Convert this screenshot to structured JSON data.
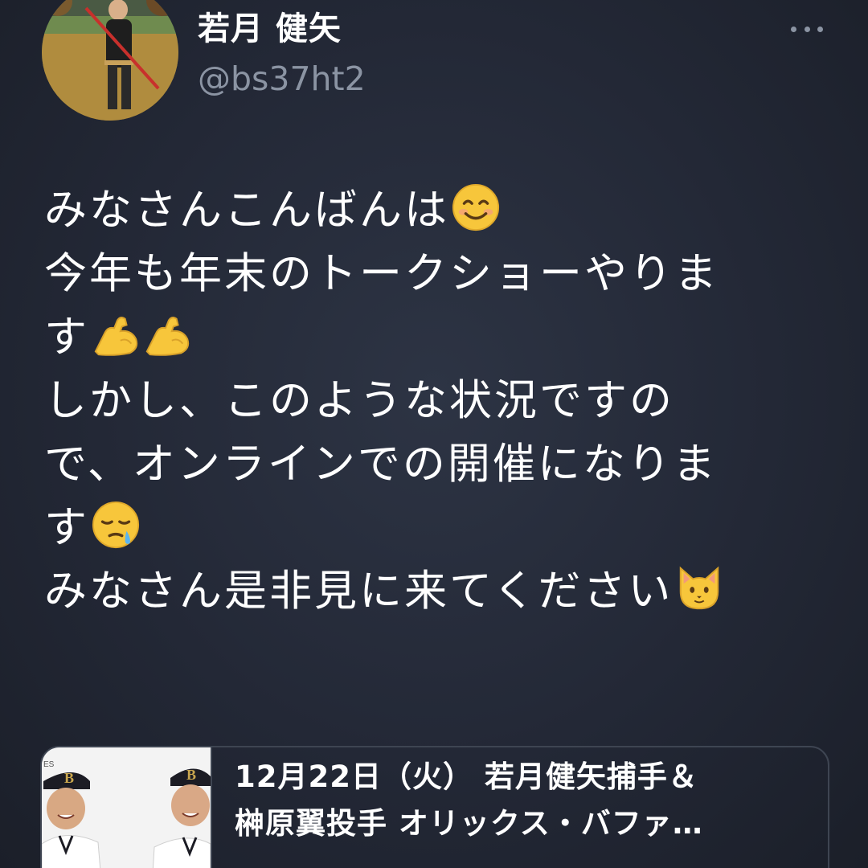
{
  "header": {
    "display_name": "若月 健矢",
    "handle": "@bs37ht2",
    "more_icon": "more-horizontal-icon"
  },
  "tweet": {
    "lines": [
      {
        "text": "みなさんこんばんは",
        "emoji": [
          "smiling-face-icon"
        ]
      },
      {
        "text": "今年も年末のトークショーやりま",
        "emoji": []
      },
      {
        "text": "す",
        "emoji": [
          "flexed-biceps-icon",
          "flexed-biceps-icon"
        ]
      },
      {
        "text": "しかし、このような状況ですの",
        "emoji": []
      },
      {
        "text": "で、オンラインでの開催になりま",
        "emoji": []
      },
      {
        "text": "す",
        "emoji": [
          "sleepy-face-icon"
        ]
      },
      {
        "text": "みなさん是非見に来てください",
        "emoji": [
          "cat-face-icon"
        ]
      }
    ]
  },
  "link_card": {
    "title_line1": "12月22日（火） 若月健矢捕手＆",
    "title_line2": "榊原翼投手 オリックス・バファ…"
  },
  "colors": {
    "background": "#232836",
    "text": "#ffffff",
    "secondary_text": "#8b94a3",
    "card_border": "#3e4552"
  }
}
